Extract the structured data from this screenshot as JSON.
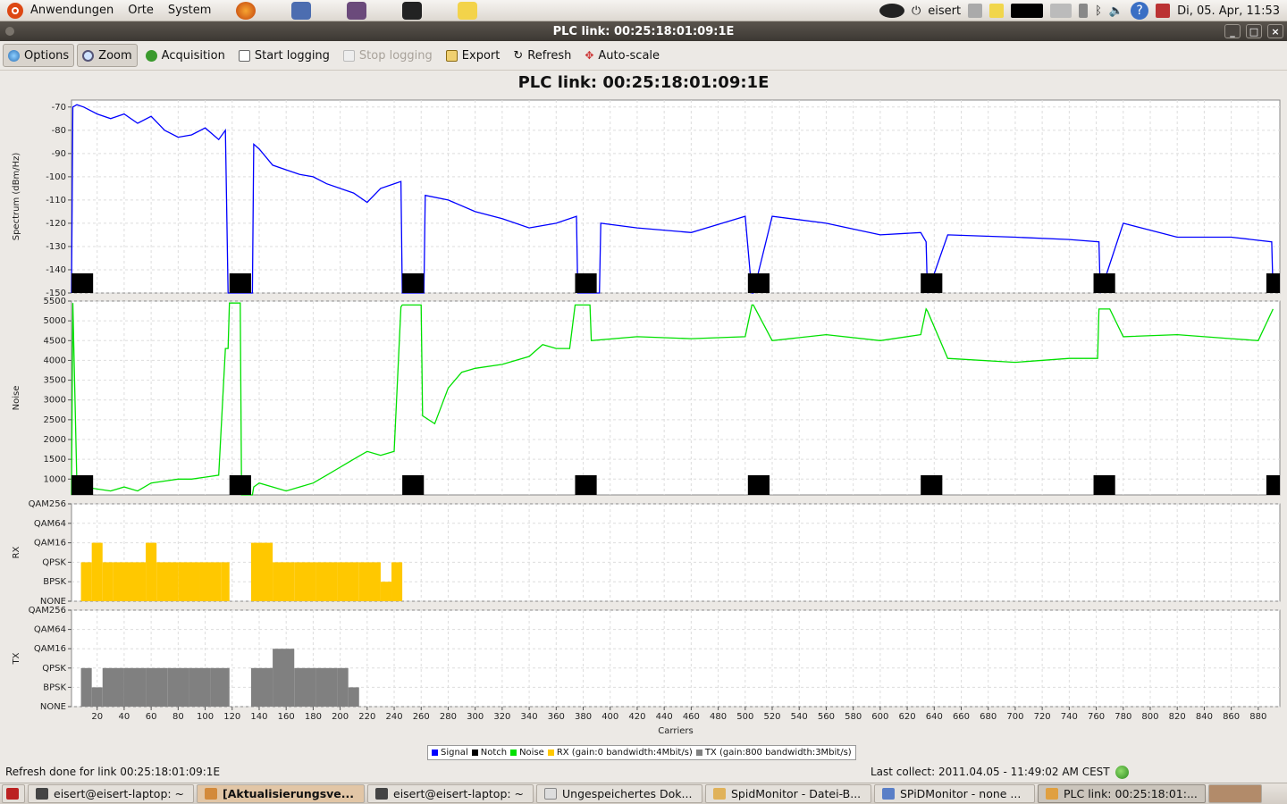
{
  "top_panel": {
    "menus": [
      "Anwendungen",
      "Orte",
      "System"
    ],
    "user": "eisert",
    "clock": "Di, 05. Apr, 11:53"
  },
  "window": {
    "title": "PLC link: 00:25:18:01:09:1E",
    "buttons": [
      "_",
      "□",
      "×"
    ]
  },
  "toolbar": {
    "options": "Options",
    "zoom": "Zoom",
    "acquisition": "Acquisition",
    "start_logging": "Start logging",
    "stop_logging": "Stop logging",
    "export": "Export",
    "refresh": "Refresh",
    "autoscale": "Auto-scale"
  },
  "chart_title": "PLC link: 00:25:18:01:09:1E",
  "chart_data": [
    {
      "type": "line",
      "ylabel": "Spectrum (dBm/Hz)",
      "ylim": [
        -150,
        -67
      ],
      "yticks": [
        -70,
        -80,
        -90,
        -100,
        -110,
        -120,
        -130,
        -140,
        -150
      ],
      "series": [
        {
          "name": "Signal",
          "color": "#0000ff",
          "x": [
            1,
            2,
            5,
            10,
            20,
            30,
            40,
            50,
            60,
            70,
            80,
            90,
            100,
            110,
            115,
            117,
            118,
            135,
            136,
            140,
            150,
            160,
            170,
            180,
            190,
            200,
            210,
            220,
            230,
            240,
            245,
            246,
            262,
            263,
            280,
            300,
            320,
            340,
            360,
            375,
            376,
            392,
            393,
            420,
            460,
            500,
            505,
            506,
            520,
            560,
            600,
            630,
            634,
            635,
            650,
            700,
            740,
            762,
            763,
            780,
            820,
            860,
            890,
            891
          ],
          "y": [
            -150,
            -70,
            -69,
            -70,
            -73,
            -75,
            -73,
            -77,
            -74,
            -80,
            -83,
            -82,
            -79,
            -84,
            -80,
            -150,
            -150,
            -150,
            -86,
            -88,
            -95,
            -97,
            -99,
            -100,
            -103,
            -105,
            -107,
            -111,
            -105,
            -103,
            -102,
            -150,
            -150,
            -108,
            -110,
            -115,
            -118,
            -122,
            -120,
            -117,
            -150,
            -150,
            -120,
            -122,
            -124,
            -117,
            -150,
            -150,
            -117,
            -120,
            -125,
            -124,
            -128,
            -150,
            -125,
            -126,
            -127,
            -128,
            -150,
            -120,
            -126,
            -126,
            -128,
            -150
          ]
        },
        {
          "name": "Notch",
          "color": "#000000",
          "x": [
            1,
            118,
            246,
            374,
            502,
            630,
            758,
            886
          ],
          "width": 16
        }
      ]
    },
    {
      "type": "line",
      "ylabel": "Noise",
      "ylim": [
        600,
        5500
      ],
      "yticks": [
        1000,
        1500,
        2000,
        2500,
        3000,
        3500,
        4000,
        4500,
        5000,
        5500
      ],
      "series": [
        {
          "name": "Noise",
          "color": "#00e000",
          "x": [
            1,
            2,
            5,
            10,
            20,
            30,
            40,
            50,
            60,
            70,
            80,
            90,
            100,
            110,
            115,
            117,
            118,
            126,
            127,
            135,
            136,
            140,
            150,
            160,
            170,
            180,
            190,
            200,
            210,
            220,
            230,
            240,
            245,
            246,
            260,
            261,
            270,
            280,
            290,
            300,
            320,
            340,
            350,
            360,
            370,
            374,
            375,
            385,
            386,
            420,
            460,
            500,
            505,
            506,
            520,
            560,
            600,
            630,
            634,
            635,
            650,
            700,
            740,
            761,
            762,
            770,
            780,
            820,
            860,
            880,
            891
          ],
          "y": [
            600,
            5450,
            900,
            800,
            750,
            700,
            800,
            700,
            900,
            950,
            1000,
            1000,
            1050,
            1100,
            4300,
            4300,
            5450,
            5450,
            600,
            600,
            800,
            900,
            800,
            700,
            800,
            900,
            1100,
            1300,
            1500,
            1700,
            1600,
            1700,
            5350,
            5400,
            5400,
            2600,
            2400,
            3300,
            3700,
            3800,
            3900,
            4100,
            4400,
            4300,
            4300,
            5400,
            5400,
            5400,
            4500,
            4600,
            4550,
            4600,
            5400,
            5400,
            4500,
            4650,
            4500,
            4650,
            5300,
            5250,
            4050,
            3950,
            4050,
            4050,
            5300,
            5300,
            4600,
            4650,
            4550,
            4500,
            5300
          ]
        },
        {
          "name": "Notch",
          "color": "#000000",
          "x": [
            1,
            118,
            246,
            374,
            502,
            630,
            758,
            886
          ],
          "width": 16
        }
      ]
    },
    {
      "type": "bar",
      "ylabel": "RX",
      "levels": [
        "NONE",
        "BPSK",
        "QPSK",
        "QAM16",
        "QAM64",
        "QAM256"
      ],
      "series": [
        {
          "name": "RX (gain:0 bandwidth:4Mbit/s)",
          "color": "#ffc800",
          "x": [
            1,
            8,
            16,
            24,
            32,
            48,
            56,
            64,
            80,
            96,
            112,
            118,
            134,
            142,
            150,
            166,
            182,
            198,
            214,
            230,
            238,
            246
          ],
          "y": [
            0,
            2,
            3,
            2,
            2,
            2,
            3,
            2,
            2,
            2,
            2,
            0,
            3,
            3,
            2,
            2,
            2,
            2,
            2,
            1,
            2,
            0
          ]
        }
      ]
    },
    {
      "type": "bar",
      "ylabel": "TX",
      "levels": [
        "NONE",
        "BPSK",
        "QPSK",
        "QAM16",
        "QAM64",
        "QAM256"
      ],
      "series": [
        {
          "name": "TX (gain:800 bandwidth:3Mbit/s)",
          "color": "#808080",
          "x": [
            1,
            8,
            16,
            24,
            40,
            56,
            72,
            88,
            104,
            118,
            134,
            142,
            150,
            166,
            182,
            198,
            206,
            214
          ],
          "y": [
            0,
            2,
            1,
            2,
            2,
            2,
            2,
            2,
            2,
            0,
            2,
            2,
            3,
            2,
            2,
            2,
            1,
            0
          ]
        }
      ]
    }
  ],
  "x_axis": {
    "label": "Carriers",
    "ticks": [
      20,
      40,
      60,
      80,
      100,
      120,
      140,
      160,
      180,
      200,
      220,
      240,
      260,
      280,
      300,
      320,
      340,
      360,
      380,
      400,
      420,
      440,
      460,
      480,
      500,
      520,
      540,
      560,
      580,
      600,
      620,
      640,
      660,
      680,
      700,
      720,
      740,
      760,
      780,
      800,
      820,
      840,
      860,
      880
    ],
    "range": [
      1,
      896
    ]
  },
  "legend": {
    "signal": "Signal",
    "notch": "Notch",
    "noise": "Noise",
    "rx": "RX (gain:0 bandwidth:4Mbit/s)",
    "tx": "TX (gain:800 bandwidth:3Mbit/s)"
  },
  "status": {
    "left": "Refresh done for link 00:25:18:01:09:1E",
    "right": "Last collect: 2011.04.05  -  11:49:02 AM CEST"
  },
  "taskbar": {
    "items": [
      "eisert@eisert-laptop: ~",
      "[Aktualisierungsve...",
      "eisert@eisert-laptop: ~",
      "Ungespeichertes Dok...",
      "SpidMonitor - Datei-B...",
      "SPiDMonitor - none ...",
      "PLC link: 00:25:18:01:..."
    ]
  },
  "colors": {
    "signal": "#0000ff",
    "notch": "#000000",
    "noise": "#00e000",
    "rx": "#ffc800",
    "tx": "#808080"
  }
}
